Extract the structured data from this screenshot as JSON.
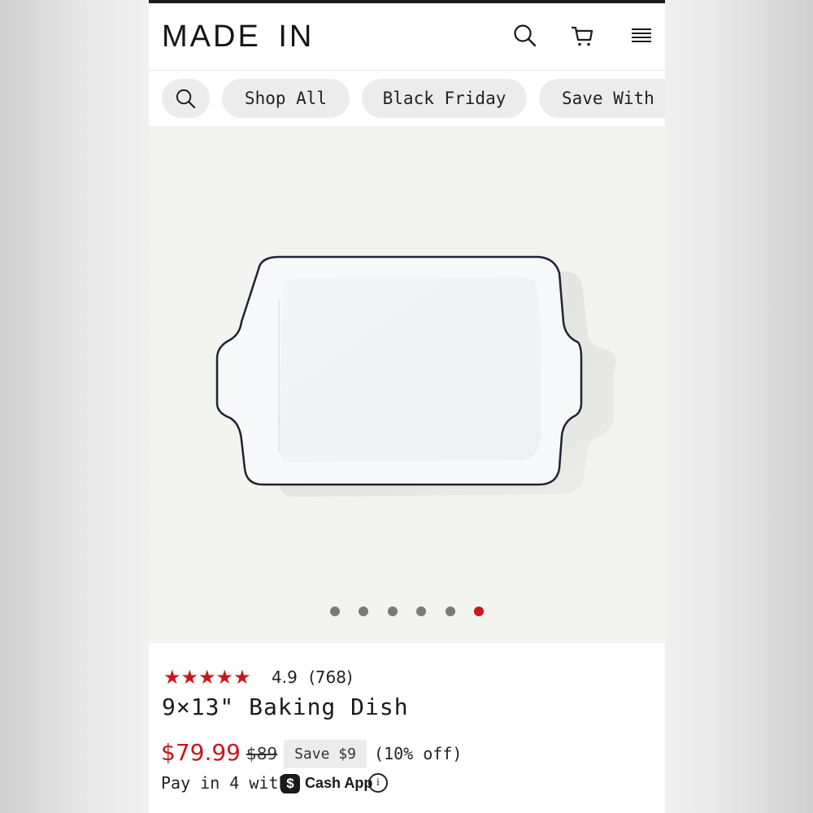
{
  "header": {
    "logo": "MADE  IN",
    "icons": [
      "search-icon",
      "cart-icon",
      "menu-icon"
    ]
  },
  "chips": {
    "shop_all": "Shop All",
    "black_friday": "Black Friday",
    "save_with": "Save With S"
  },
  "carousel": {
    "image": "baking-dish-image",
    "total_slides": 6,
    "active_slide": 6
  },
  "product": {
    "stars": "★★★★★",
    "rating": "4.9",
    "reviews": "(768)",
    "title": "9×13\" Baking Dish",
    "price": "$79.99",
    "old_price": "$89",
    "save_badge": "Save $9",
    "discount": "(10% off)",
    "pay_in": "Pay in 4 with",
    "cash_app_logo": "$",
    "cash_app": "Cash App",
    "info_icon": "i"
  },
  "colors": {
    "accent_red": "#c8161d",
    "chip_bg": "#ececec",
    "product_bg": "#f3f3ef"
  }
}
